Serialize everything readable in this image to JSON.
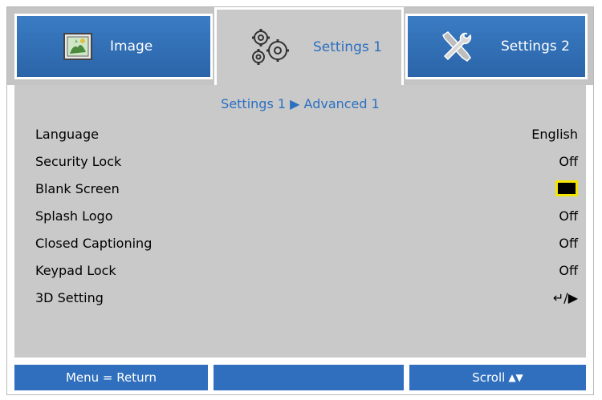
{
  "tabs": [
    {
      "label": "Image",
      "icon": "image-icon",
      "active": false
    },
    {
      "label": "Settings 1",
      "icon": "gears-icon",
      "active": true
    },
    {
      "label": "Settings 2",
      "icon": "tools-icon",
      "active": false
    }
  ],
  "breadcrumb": "Settings 1 ▶ Advanced 1",
  "settings": [
    {
      "label": "Language",
      "value": "English"
    },
    {
      "label": "Security Lock",
      "value": "Off"
    },
    {
      "label": "Blank Screen",
      "value": "",
      "swatch": "#000000"
    },
    {
      "label": "Splash Logo",
      "value": "Off"
    },
    {
      "label": "Closed Captioning",
      "value": "Off"
    },
    {
      "label": "Keypad Lock",
      "value": "Off"
    },
    {
      "label": "3D Setting",
      "value": "↵/▶"
    }
  ],
  "footer": {
    "left": "Menu = Return",
    "middle": "",
    "right": "Scroll",
    "right_arrows": "▲▼"
  },
  "colors": {
    "accent_blue": "#2b6fc1",
    "tab_blue": "#3a7cc4",
    "panel_gray": "#c9c9c9",
    "highlight_yellow": "#f2e600"
  }
}
